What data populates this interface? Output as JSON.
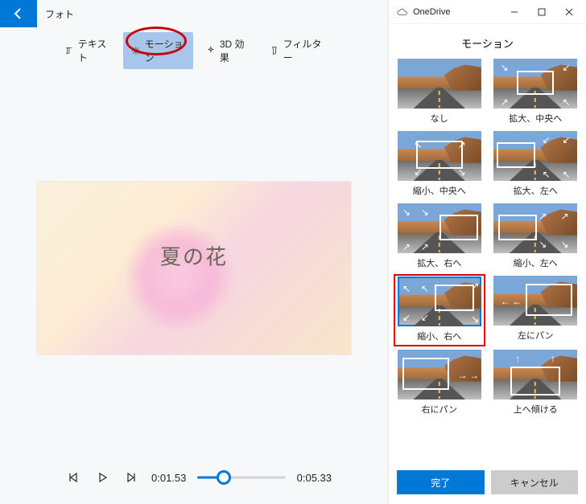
{
  "app": {
    "title": "フォト"
  },
  "toolbar": {
    "text_label": "テキスト",
    "motion_label": "モーション",
    "effects_label": "3D 効果",
    "filter_label": "フィルター",
    "selected": "motion"
  },
  "preview": {
    "caption": "夏の花"
  },
  "player": {
    "current": "0:01.53",
    "total": "0:05.33",
    "progress_pct": 30
  },
  "side_window": {
    "provider": "OneDrive",
    "panel_title": "モーション",
    "done_label": "完了",
    "cancel_label": "キャンセル"
  },
  "motion_options": [
    {
      "id": "none",
      "label": "なし",
      "overlay": "none"
    },
    {
      "id": "zoom-in-center",
      "label": "拡大、中央へ",
      "overlay": "in-center"
    },
    {
      "id": "zoom-out-center",
      "label": "縮小、中央へ",
      "overlay": "out-center"
    },
    {
      "id": "zoom-in-left",
      "label": "拡大、左へ",
      "overlay": "in-left"
    },
    {
      "id": "zoom-in-right",
      "label": "拡大、右へ",
      "overlay": "in-right"
    },
    {
      "id": "zoom-out-left",
      "label": "縮小、左へ",
      "overlay": "out-left"
    },
    {
      "id": "zoom-out-right",
      "label": "縮小、右へ",
      "overlay": "out-right",
      "selected": true,
      "annotated": true
    },
    {
      "id": "pan-left",
      "label": "左にパン",
      "overlay": "pan-left"
    },
    {
      "id": "pan-right",
      "label": "右にパン",
      "overlay": "pan-right"
    },
    {
      "id": "tilt-up",
      "label": "上へ傾ける",
      "overlay": "tilt-up"
    }
  ]
}
